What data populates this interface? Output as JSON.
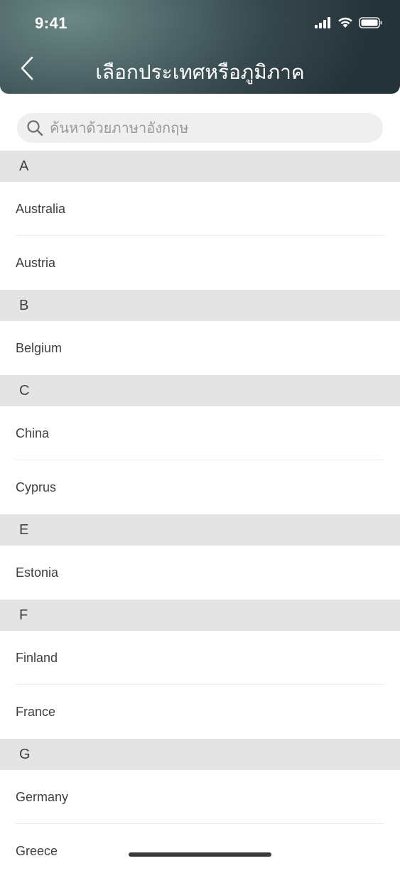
{
  "status_bar": {
    "time": "9:41",
    "icons": [
      "signal-icon",
      "wifi-icon",
      "battery-icon"
    ]
  },
  "header": {
    "title": "เลือกประเทศหรือภูมิภาค",
    "back_icon": "chevron-left-icon"
  },
  "search": {
    "placeholder": "ค้นหาด้วยภาษาอังกฤษ",
    "value": ""
  },
  "sections": [
    {
      "letter": "A",
      "countries": [
        "Australia",
        "Austria"
      ]
    },
    {
      "letter": "B",
      "countries": [
        "Belgium"
      ]
    },
    {
      "letter": "C",
      "countries": [
        "China",
        "Cyprus"
      ]
    },
    {
      "letter": "E",
      "countries": [
        "Estonia"
      ]
    },
    {
      "letter": "F",
      "countries": [
        "Finland",
        "France"
      ]
    },
    {
      "letter": "G",
      "countries": [
        "Germany",
        "Greece"
      ]
    }
  ],
  "colors": {
    "header_gradient_light": "#6c8786",
    "header_gradient_dark": "#25343a",
    "section_bg": "#e4e4e4",
    "search_bg": "#efefef"
  }
}
